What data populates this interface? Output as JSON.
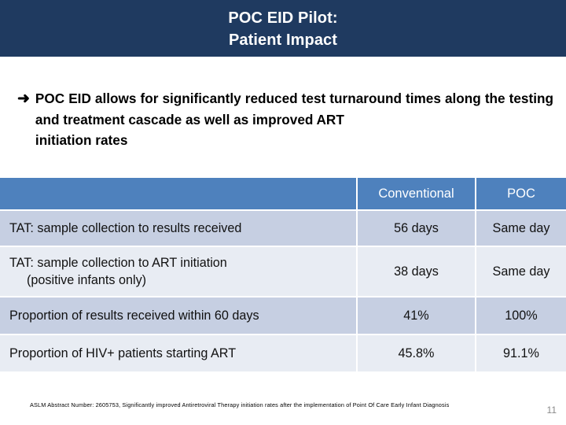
{
  "slide": {
    "title_line1": "POC EID Pilot:",
    "title_line2": "Patient Impact",
    "title_band_color": "#1F3A60",
    "page_number": "11"
  },
  "bullet": {
    "marker": "➜",
    "text_main": "POC EID allows for significantly reduced test turnaround times along the testing and treatment cascade as well as improved ART",
    "text_tail": "initiation rates"
  },
  "table": {
    "header_color": "#4E81BD",
    "row_dark_color": "#C6CFE2",
    "row_light_color": "#E8ECF3",
    "columns": [
      "",
      "Conventional",
      "POC"
    ],
    "rows": [
      {
        "label": "TAT: sample collection to results received",
        "label_second": "",
        "conventional": "56 days",
        "poc": "Same day"
      },
      {
        "label": "TAT: sample collection to ART initiation",
        "label_second": "(positive infants only)",
        "conventional": "38 days",
        "poc": "Same day"
      },
      {
        "label": "Proportion of results received within 60 days",
        "label_second": "",
        "conventional": "41%",
        "poc": "100%"
      },
      {
        "label": "Proportion of HIV+ patients starting ART",
        "label_second": "",
        "conventional": "45.8%",
        "poc": "91.1%"
      }
    ]
  },
  "footer": {
    "note": "ASLM Abstract Number: 2605753, Significantly improved Antiretroviral Therapy initiation rates after the implementation of Point Of Care Early Infant Diagnosis"
  }
}
